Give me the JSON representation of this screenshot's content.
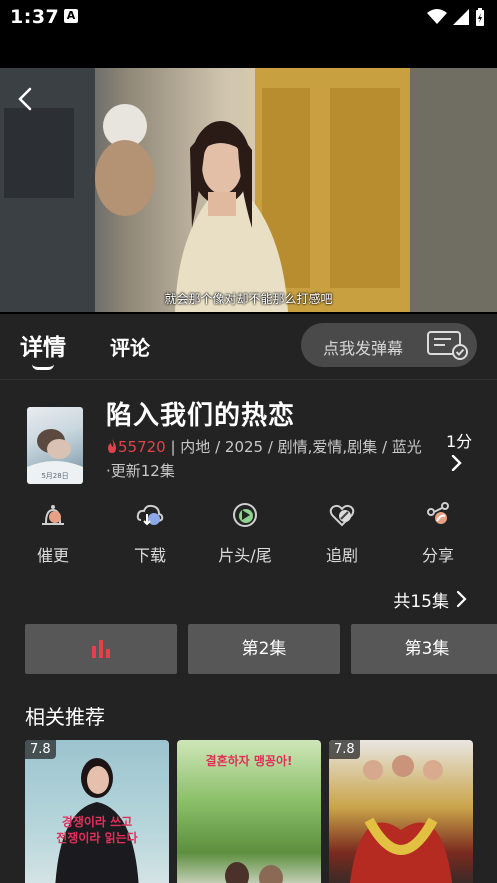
{
  "status": {
    "time": "1:37",
    "notif_letter": "A"
  },
  "video": {
    "subtitle": "就会那个像对却不能那么打感吧",
    "back_icon": "chevron-left-icon"
  },
  "tabs": {
    "details": "详情",
    "comments": "评论",
    "danmaku_placeholder": "点我发弹幕"
  },
  "show": {
    "title": "陷入我们的热恋",
    "heat": "55720",
    "meta": " | 内地 / 2025 / 剧情,爱情,剧集 / 蓝光·更新12集",
    "score": "1分",
    "poster_caption": "5月28日"
  },
  "actions": [
    {
      "label": "催更",
      "icon": "urge-icon"
    },
    {
      "label": "下载",
      "icon": "download-icon"
    },
    {
      "label": "片头/尾",
      "icon": "play-skip-icon"
    },
    {
      "label": "追剧",
      "icon": "follow-icon"
    },
    {
      "label": "分享",
      "icon": "share-icon"
    }
  ],
  "episodes": {
    "count_label": "共15集",
    "items": [
      "",
      "第2集",
      "第3集"
    ],
    "playing_color": "#e5414a"
  },
  "recommendations": {
    "title": "相关推荐",
    "items": [
      {
        "score": "7.8",
        "hangul": ""
      },
      {
        "score": "",
        "hangul": "결혼하자 맹꽁아!"
      },
      {
        "score": "7.8",
        "hangul": ""
      }
    ]
  },
  "colors": {
    "background": "#232323",
    "accent": "#e5414a",
    "button": "#575757"
  }
}
